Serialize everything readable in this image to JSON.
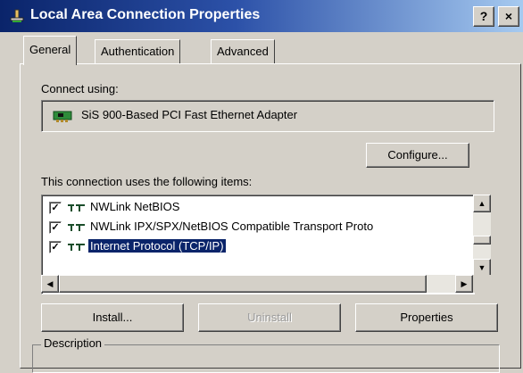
{
  "window": {
    "title": "Local Area Connection Properties",
    "help_label": "?",
    "close_label": "×"
  },
  "tabs": [
    {
      "label": "General",
      "active": true
    },
    {
      "label": "Authentication",
      "active": false
    },
    {
      "label": "Advanced",
      "active": false
    }
  ],
  "general": {
    "connect_using_label": "Connect using:",
    "adapter_name": "SiS 900-Based PCI Fast Ethernet Adapter",
    "configure_label": "Configure...",
    "items_label": "This connection uses the following items:",
    "items": [
      {
        "label": "NWLink NetBIOS",
        "checked": true,
        "selected": false
      },
      {
        "label": "NWLink IPX/SPX/NetBIOS Compatible Transport Proto",
        "checked": true,
        "selected": false
      },
      {
        "label": "Internet Protocol (TCP/IP)",
        "checked": true,
        "selected": true
      }
    ],
    "install_label": "Install...",
    "uninstall_label": "Uninstall",
    "properties_label": "Properties",
    "description_label": "Description"
  },
  "colors": {
    "titlebar_start": "#0a246a",
    "titlebar_end": "#a6caf0",
    "selection": "#0a246a",
    "face": "#d4d0c8"
  },
  "icons": {
    "title": "network-connection-icon",
    "adapter": "network-adapter-icon",
    "protocol": "network-protocol-icon"
  }
}
